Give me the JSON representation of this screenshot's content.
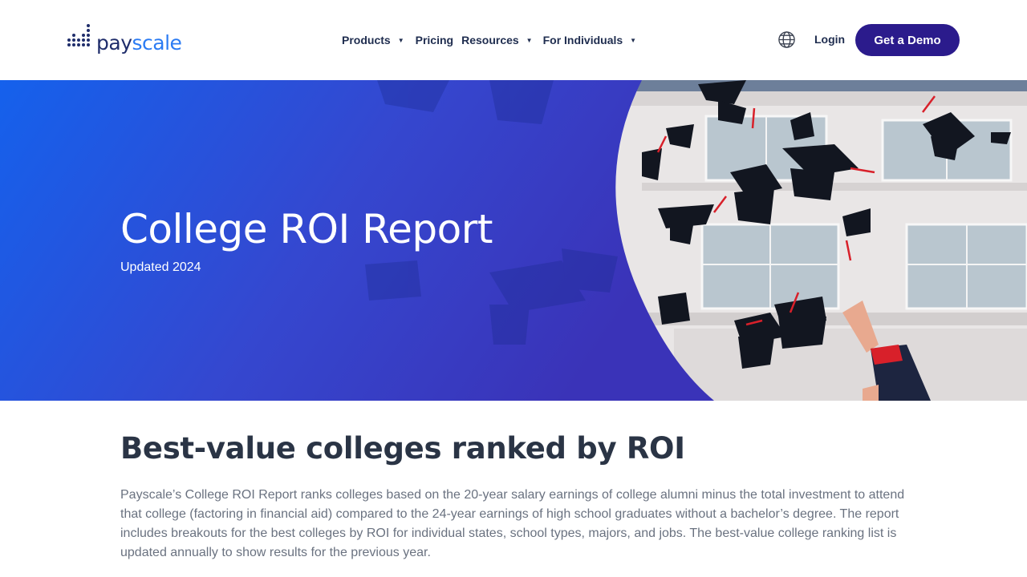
{
  "brand": {
    "name_part1": "pay",
    "name_part2": "scale"
  },
  "nav": {
    "items": [
      {
        "label": "Products",
        "has_dropdown": true
      },
      {
        "label": "Pricing",
        "has_dropdown": false
      },
      {
        "label": "Resources",
        "has_dropdown": true
      },
      {
        "label": "For Individuals",
        "has_dropdown": true
      }
    ],
    "language_icon": "globe-icon",
    "login_label": "Login",
    "cta_label": "Get a Demo"
  },
  "hero": {
    "title": "College ROI Report",
    "subtitle": "Updated 2024"
  },
  "main": {
    "heading": "Best-value colleges ranked by ROI",
    "body": "Payscale’s College ROI Report ranks colleges based on the 20-year salary earnings of college alumni minus the total investment to attend that college (factoring in financial aid) compared to the 24-year earnings of high school graduates without a bachelor’s degree. The report includes breakouts for the best colleges by ROI for individual states, school types, majors, and jobs. The best-value college ranking list is updated annually to show results for the previous year."
  },
  "colors": {
    "brand_navy": "#1f2d6b",
    "brand_blue": "#2b7bf3",
    "cta_purple": "#2b1b8c",
    "hero_blue": "#1a5fe6"
  }
}
